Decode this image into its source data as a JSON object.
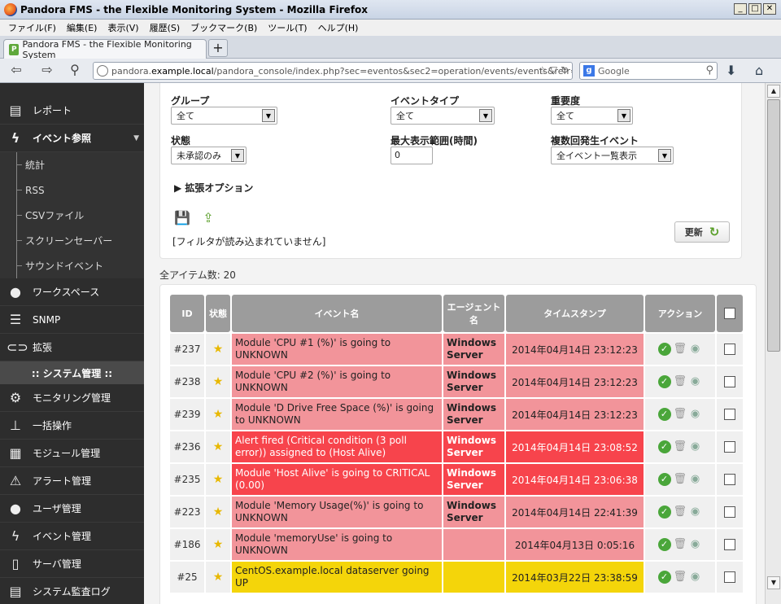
{
  "window": {
    "title": "Pandora FMS - the Flexible Monitoring System - Mozilla Firefox"
  },
  "menu": [
    "ファイル(F)",
    "編集(E)",
    "表示(V)",
    "履歴(S)",
    "ブックマーク(B)",
    "ツール(T)",
    "ヘルプ(H)"
  ],
  "tab": {
    "label": "Pandora FMS - the Flexible Monitoring System",
    "new_tab": "+"
  },
  "url": {
    "prefix": "pandora.",
    "host": "example.local",
    "path": "/pandora_console/index.php?sec=eventos&sec2=operation/events/events&refr="
  },
  "search": {
    "placeholder": "Google",
    "engine": "g"
  },
  "sidebar": {
    "items_top": [
      {
        "label": "レポート",
        "icon": "report-icon"
      },
      {
        "label": "イベント参照",
        "icon": "lightning-icon",
        "active": true
      }
    ],
    "subitems": [
      "統計",
      "RSS",
      "CSVファイル",
      "スクリーンセーバー",
      "サウンドイベント"
    ],
    "items_mid": [
      {
        "label": "ワークスペース",
        "icon": "user-icon"
      },
      {
        "label": "SNMP",
        "icon": "snmp-icon"
      },
      {
        "label": "拡張",
        "icon": "plug-icon"
      }
    ],
    "section": ":: システム管理 ::",
    "items_admin": [
      {
        "label": "モニタリング管理",
        "icon": "monitoring-icon"
      },
      {
        "label": "一括操作",
        "icon": "hierarchy-icon"
      },
      {
        "label": "モジュール管理",
        "icon": "module-icon"
      },
      {
        "label": "アラート管理",
        "icon": "alert-icon"
      },
      {
        "label": "ユーザ管理",
        "icon": "user-gear-icon"
      },
      {
        "label": "イベント管理",
        "icon": "event-gear-icon"
      },
      {
        "label": "サーバ管理",
        "icon": "server-icon"
      },
      {
        "label": "システム監査ログ",
        "icon": "audit-log-icon"
      }
    ]
  },
  "filter": {
    "group_label": "グループ",
    "group_value": "全て",
    "event_type_label": "イベントタイプ",
    "event_type_value": "全て",
    "severity_label": "重要度",
    "severity_value": "全て",
    "status_label": "状態",
    "status_value": "未承認のみ",
    "max_hours_label": "最大表示範囲(時間)",
    "max_hours_value": "0",
    "repeated_label": "複数回発生イベント",
    "repeated_value": "全イベント一覧表示",
    "advanced_label": "拡張オプション",
    "no_filter_text": "[フィルタが読み込まれていません]",
    "update_label": "更新"
  },
  "total_items": "全アイテム数: 20",
  "table": {
    "headers": {
      "id": "ID",
      "status": "状態",
      "event_name": "イベント名",
      "agent_name": "エージェント名",
      "timestamp": "タイムスタンプ",
      "action": "アクション"
    },
    "rows": [
      {
        "id": "#237",
        "name": "Module 'CPU #1 (%)' is going to UNKNOWN",
        "agent": "Windows Server",
        "timestamp": "2014年04月14日 23:12:23",
        "severity": "warning"
      },
      {
        "id": "#238",
        "name": "Module 'CPU #2 (%)' is going to UNKNOWN",
        "agent": "Windows Server",
        "timestamp": "2014年04月14日 23:12:23",
        "severity": "warning"
      },
      {
        "id": "#239",
        "name": "Module 'D Drive Free Space (%)' is going to UNKNOWN",
        "agent": "Windows Server",
        "timestamp": "2014年04月14日 23:12:23",
        "severity": "warning"
      },
      {
        "id": "#236",
        "name": "Alert fired (Critical condition (3 poll error)) assigned to (Host Alive)",
        "agent": "Windows Server",
        "timestamp": "2014年04月14日 23:08:52",
        "severity": "critical"
      },
      {
        "id": "#235",
        "name": "Module 'Host Alive' is going to CRITICAL (0.00)",
        "agent": "Windows Server",
        "timestamp": "2014年04月14日 23:06:38",
        "severity": "critical"
      },
      {
        "id": "#223",
        "name": "Module 'Memory Usage(%)' is going to UNKNOWN",
        "agent": "Windows Server",
        "timestamp": "2014年04月14日 22:41:39",
        "severity": "warning"
      },
      {
        "id": "#186",
        "name": "Module 'memoryUse' is going to UNKNOWN",
        "agent": "",
        "timestamp": "2014年04月13日 0:05:16",
        "severity": "warning"
      },
      {
        "id": "#25",
        "name": "CentOS.example.local dataserver going UP",
        "agent": "",
        "timestamp": "2014年03月22日 23:38:59",
        "severity": "normal"
      }
    ]
  },
  "colors": {
    "warning": "#f2949a",
    "critical": "#f7444c",
    "normal": "#f4d50a",
    "sidebar": "#2d2d2d"
  }
}
